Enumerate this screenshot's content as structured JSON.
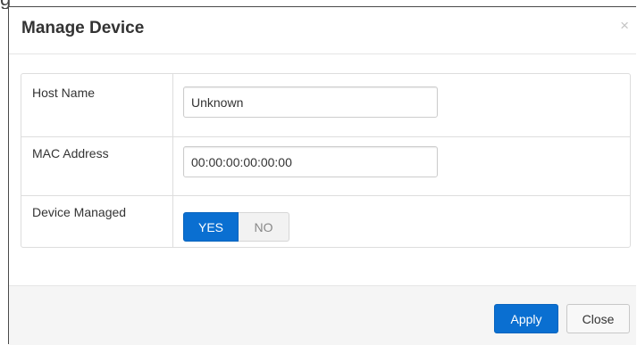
{
  "modal": {
    "title": "Manage Device",
    "close_symbol": "×"
  },
  "form": {
    "host_name": {
      "label": "Host Name",
      "value": "Unknown"
    },
    "mac_address": {
      "label": "MAC Address",
      "value": "00:00:00:00:00:00"
    },
    "device_managed": {
      "label": "Device Managed",
      "yes_label": "YES",
      "no_label": "NO",
      "selected": "YES"
    }
  },
  "footer": {
    "apply_label": "Apply",
    "close_label": "Close"
  },
  "colors": {
    "primary": "#0a6fd1",
    "border": "#dddddd",
    "footer_bg": "#f5f5f5"
  }
}
